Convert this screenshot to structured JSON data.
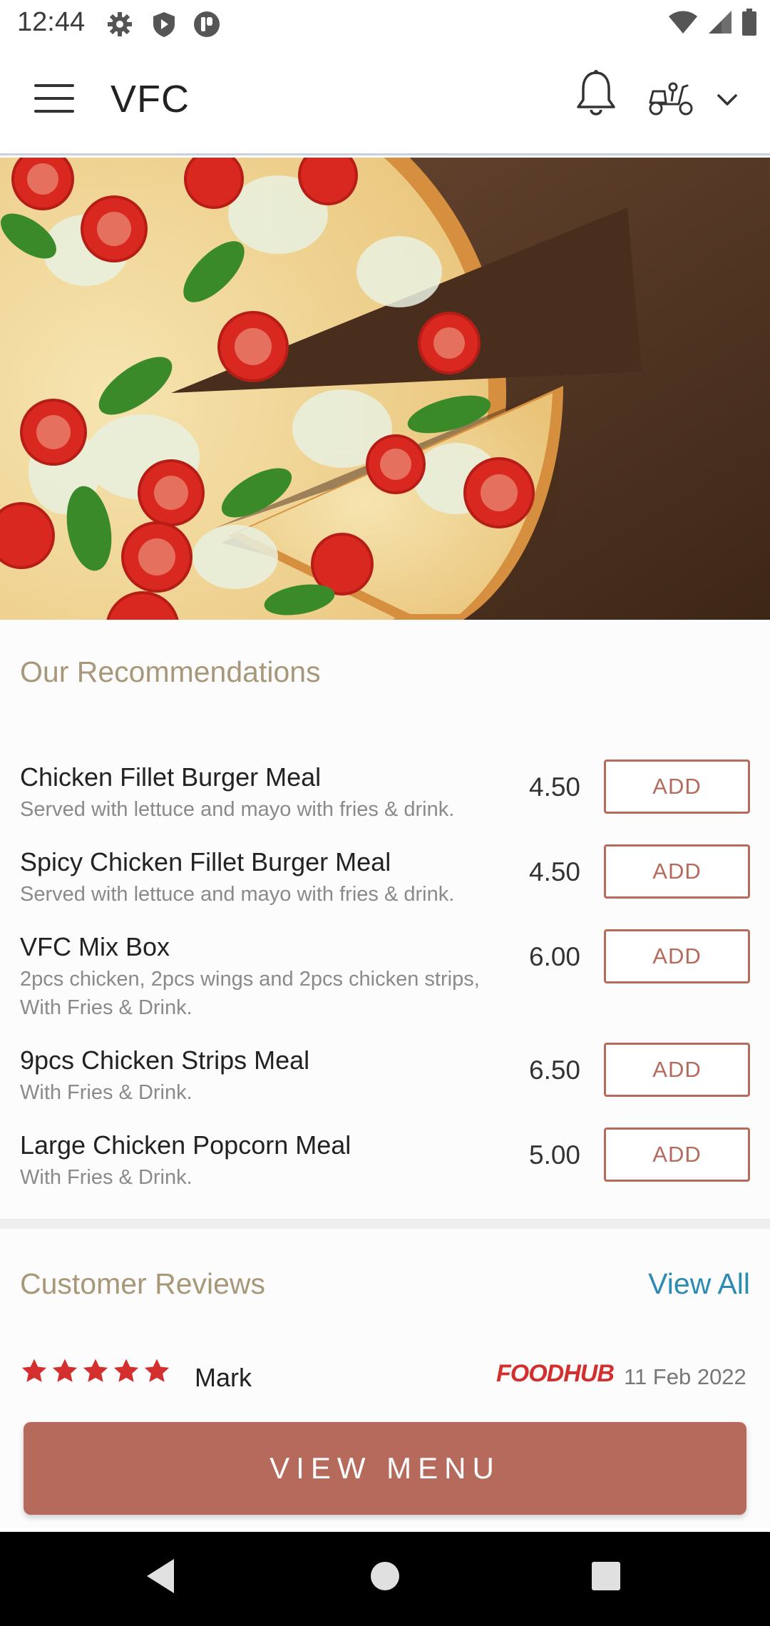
{
  "status_bar": {
    "time": "12:44",
    "icons": [
      "settings-icon",
      "shield-icon",
      "vpn-app-icon"
    ],
    "right_icons": [
      "wifi-icon",
      "signal-icon",
      "battery-icon"
    ]
  },
  "app_bar": {
    "title": "VFC",
    "icons": [
      "menu-icon",
      "bell-icon",
      "delivery-scooter-icon",
      "chevron-down-icon"
    ]
  },
  "hero": {
    "description_icon": "pizza-hero-image"
  },
  "recommendations": {
    "title": "Our Recommendations",
    "items": [
      {
        "name": "Chicken Fillet Burger Meal",
        "description": "Served with lettuce and mayo with fries & drink.",
        "price": "4.50",
        "button": "ADD"
      },
      {
        "name": "Spicy Chicken Fillet Burger Meal",
        "description": "Served with lettuce and mayo with fries & drink.",
        "price": "4.50",
        "button": "ADD"
      },
      {
        "name": "VFC Mix Box",
        "description": "2pcs chicken, 2pcs wings and 2pcs chicken strips, With Fries & Drink.",
        "price": "6.00",
        "button": "ADD"
      },
      {
        "name": "9pcs Chicken Strips Meal",
        "description": "With Fries & Drink.",
        "price": "6.50",
        "button": "ADD"
      },
      {
        "name": "Large Chicken Popcorn Meal",
        "description": "With Fries & Drink.",
        "price": "5.00",
        "button": "ADD"
      }
    ]
  },
  "reviews": {
    "title": "Customer Reviews",
    "view_all": "View All",
    "items": [
      {
        "rating": 5,
        "reviewer": "Mark",
        "source": "FOODHUB",
        "date": "11 Feb 2022"
      }
    ]
  },
  "view_menu_button": "VIEW MENU",
  "colors": {
    "accent": "#b66a5b",
    "section_title": "#a8987a",
    "link": "#2b8bb3",
    "star": "#d32f2f"
  },
  "nav_bar": {
    "icons": [
      "back-icon",
      "home-icon",
      "recents-icon"
    ]
  }
}
